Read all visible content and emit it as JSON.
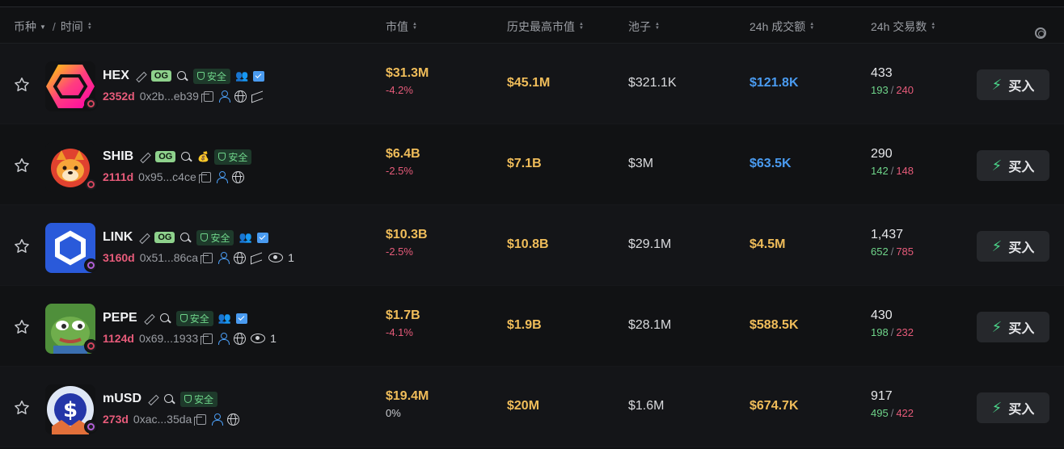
{
  "header": {
    "coin_label": "币种",
    "separator": "/",
    "time_label": "时间",
    "market_cap": "市值",
    "ath_market_cap": "历史最高市值",
    "pool": "池子",
    "volume_24h": "24h 成交额",
    "txns_24h": "24h 交易数"
  },
  "colors": {
    "background": "#111214",
    "gold": "#f0bd5a",
    "blue": "#4a9bf0",
    "green": "#6fd58a",
    "red": "#e75b7a"
  },
  "rows": [
    {
      "symbol": "HEX",
      "og": "OG",
      "safe": "安全",
      "age": "2352d",
      "address": "0x2b...eb39",
      "market_cap": "$31.3M",
      "change": "-4.2%",
      "ath": "$45.1M",
      "pool": "$321.1K",
      "volume": "$121.8K",
      "txns": "433",
      "buys": "193",
      "sells": "240",
      "buy_label": "买入"
    },
    {
      "symbol": "SHIB",
      "og": "OG",
      "safe": "安全",
      "age": "2111d",
      "address": "0x95...c4ce",
      "market_cap": "$6.4B",
      "change": "-2.5%",
      "ath": "$7.1B",
      "pool": "$3M",
      "volume": "$63.5K",
      "txns": "290",
      "buys": "142",
      "sells": "148",
      "buy_label": "买入"
    },
    {
      "symbol": "LINK",
      "og": "OG",
      "safe": "安全",
      "age": "3160d",
      "address": "0x51...86ca",
      "views": "1",
      "market_cap": "$10.3B",
      "change": "-2.5%",
      "ath": "$10.8B",
      "pool": "$29.1M",
      "volume": "$4.5M",
      "txns": "1,437",
      "buys": "652",
      "sells": "785",
      "buy_label": "买入"
    },
    {
      "symbol": "PEPE",
      "safe": "安全",
      "age": "1124d",
      "address": "0x69...1933",
      "views": "1",
      "market_cap": "$1.7B",
      "change": "-4.1%",
      "ath": "$1.9B",
      "pool": "$28.1M",
      "volume": "$588.5K",
      "txns": "430",
      "buys": "198",
      "sells": "232",
      "buy_label": "买入"
    },
    {
      "symbol": "mUSD",
      "safe": "安全",
      "age": "273d",
      "address": "0xac...35da",
      "market_cap": "$19.4M",
      "change": "0%",
      "ath": "$20M",
      "pool": "$1.6M",
      "volume": "$674.7K",
      "txns": "917",
      "buys": "495",
      "sells": "422",
      "buy_label": "买入"
    }
  ]
}
